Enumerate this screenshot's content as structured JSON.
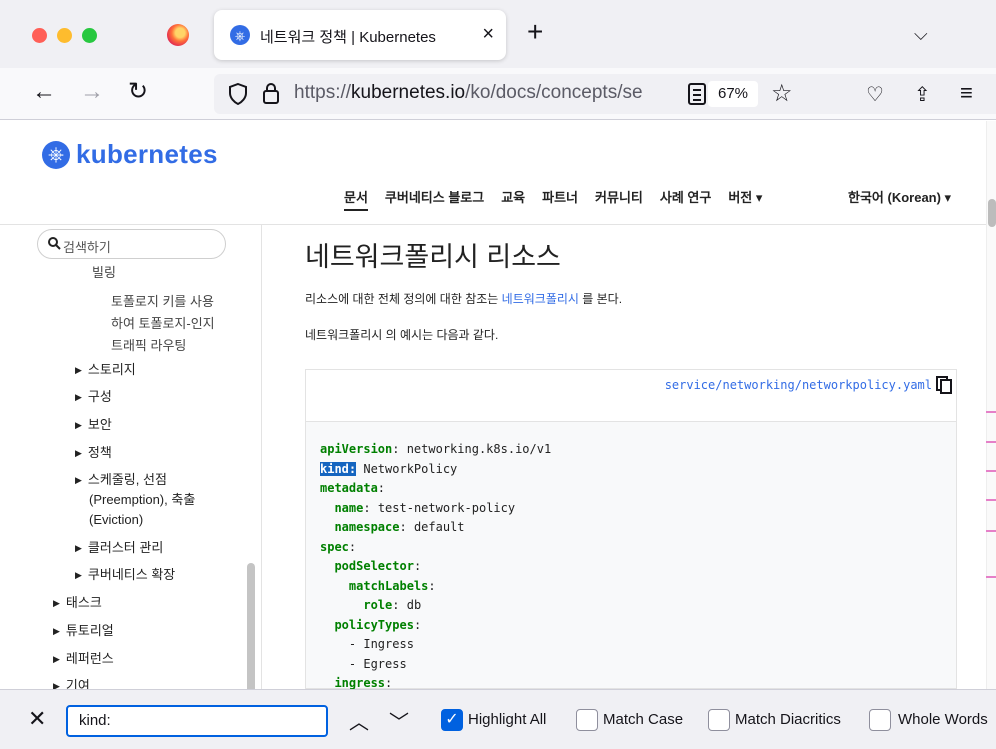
{
  "browser": {
    "tab_title": "네트워크 정책 | Kubernetes",
    "tab_close": "×",
    "new_tab": "+",
    "tab_list": "⌵",
    "url_prefix": "https://",
    "url_host": "kubernetes.io",
    "url_path": "/ko/docs/concepts/se",
    "zoom": "67%"
  },
  "site": {
    "brand": "kubernetes",
    "nav": [
      "문서",
      "쿠버네티스 블로그",
      "교육",
      "파트너",
      "커뮤니티",
      "사례 연구",
      "버전 ▾"
    ],
    "language": "한국어 (Korean) ▾"
  },
  "sidebar": {
    "search_placeholder": "검색하기",
    "text_lines": [
      "빌링",
      "토폴로지 키를 사용",
      "하여 토폴로지-인지",
      "트래픽 라우팅"
    ],
    "items": [
      {
        "label": "스토리지",
        "level": 2
      },
      {
        "label": "구성",
        "level": 2
      },
      {
        "label": "보안",
        "level": 2
      },
      {
        "label": "정책",
        "level": 2
      },
      {
        "label": "스케줄링, 선점",
        "level": 2
      },
      {
        "label": "(Preemption), 축출",
        "level": 2
      },
      {
        "label": "(Eviction)",
        "level": 2
      },
      {
        "label": "클러스터 관리",
        "level": 2
      },
      {
        "label": "쿠버네티스 확장",
        "level": 2
      },
      {
        "label": "태스크",
        "level": 1
      },
      {
        "label": "튜토리얼",
        "level": 1
      },
      {
        "label": "레퍼런스",
        "level": 1
      },
      {
        "label": "기여",
        "level": 1
      }
    ]
  },
  "content": {
    "heading": "네트워크폴리시 리소스",
    "para1_before": "리소스에 대한 전체 정의에 대한 참조는 ",
    "para1_link": "네트워크폴리시",
    "para1_after": " 를 본다.",
    "para2": "네트워크폴리시 의 예시는 다음과 같다.",
    "code_filename": "service/networking/networkpolicy.yaml",
    "code_lines": [
      {
        "key": "apiVersion",
        "value": " networking.k8s.io/v1",
        "indent": ""
      },
      {
        "key": "kind:",
        "value": " NetworkPolicy",
        "indent": "",
        "highlight": true
      },
      {
        "key": "metadata",
        "value": "",
        "indent": ""
      },
      {
        "key": "name",
        "value": " test-network-policy",
        "indent": "  "
      },
      {
        "key": "namespace",
        "value": " default",
        "indent": "  "
      },
      {
        "key": "spec",
        "value": "",
        "indent": ""
      },
      {
        "key": "podSelector",
        "value": "",
        "indent": "  "
      },
      {
        "key": "matchLabels",
        "value": "",
        "indent": "    "
      },
      {
        "key": "role",
        "value": " db",
        "indent": "      "
      },
      {
        "key": "policyTypes",
        "value": "",
        "indent": "  "
      },
      {
        "key": "",
        "value": "- Ingress",
        "indent": "    "
      },
      {
        "key": "",
        "value": "- Egress",
        "indent": "    "
      },
      {
        "key": "ingress",
        "value": "",
        "indent": "  "
      }
    ]
  },
  "findbar": {
    "close": "✕",
    "query": "kind:",
    "prev": "︿",
    "next": "﹀",
    "options": [
      {
        "label": "Highlight All",
        "checked": true
      },
      {
        "label": "Match Case",
        "checked": false
      },
      {
        "label": "Match Diacritics",
        "checked": false
      },
      {
        "label": "Whole Words",
        "checked": false
      }
    ]
  }
}
